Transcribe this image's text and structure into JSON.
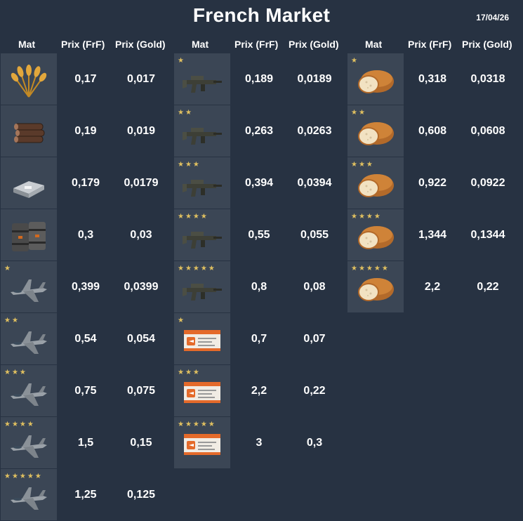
{
  "title": "French Market",
  "date": "17/04/26",
  "headers": {
    "mat": "Mat",
    "frf": "Prix (FrF)",
    "gold": "Prix (Gold)"
  },
  "columns": [
    {
      "items": [
        {
          "icon": "wheat-icon",
          "stars": "",
          "frf": "0,17",
          "gold": "0,017"
        },
        {
          "icon": "logs-icon",
          "stars": "",
          "frf": "0,19",
          "gold": "0,019"
        },
        {
          "icon": "steel-ingot-icon",
          "stars": "",
          "frf": "0,179",
          "gold": "0,0179"
        },
        {
          "icon": "oil-barrel-icon",
          "stars": "",
          "frf": "0,3",
          "gold": "0,03"
        },
        {
          "icon": "fighter-jet-icon",
          "stars": "★",
          "frf": "0,399",
          "gold": "0,0399"
        },
        {
          "icon": "fighter-jet-icon",
          "stars": "★★",
          "frf": "0,54",
          "gold": "0,054"
        },
        {
          "icon": "fighter-jet-icon",
          "stars": "★★★",
          "frf": "0,75",
          "gold": "0,075"
        },
        {
          "icon": "fighter-jet-icon",
          "stars": "★★★★",
          "frf": "1,5",
          "gold": "0,15"
        },
        {
          "icon": "fighter-jet-icon",
          "stars": "★★★★★",
          "frf": "1,25",
          "gold": "0,125"
        }
      ]
    },
    {
      "items": [
        {
          "icon": "rifle-icon",
          "stars": "★",
          "frf": "0,189",
          "gold": "0,0189"
        },
        {
          "icon": "rifle-icon",
          "stars": "★★",
          "frf": "0,263",
          "gold": "0,0263"
        },
        {
          "icon": "rifle-icon",
          "stars": "★★★",
          "frf": "0,394",
          "gold": "0,0394"
        },
        {
          "icon": "rifle-icon",
          "stars": "★★★★",
          "frf": "0,55",
          "gold": "0,055"
        },
        {
          "icon": "rifle-icon",
          "stars": "★★★★★",
          "frf": "0,8",
          "gold": "0,08"
        },
        {
          "icon": "plane-ticket-icon",
          "stars": "★",
          "frf": "0,7",
          "gold": "0,07"
        },
        {
          "icon": "plane-ticket-icon",
          "stars": "★★★",
          "frf": "2,2",
          "gold": "0,22"
        },
        {
          "icon": "plane-ticket-icon",
          "stars": "★★★★★",
          "frf": "3",
          "gold": "0,3"
        }
      ]
    },
    {
      "items": [
        {
          "icon": "bread-icon",
          "stars": "★",
          "frf": "0,318",
          "gold": "0,0318"
        },
        {
          "icon": "bread-icon",
          "stars": "★★",
          "frf": "0,608",
          "gold": "0,0608"
        },
        {
          "icon": "bread-icon",
          "stars": "★★★",
          "frf": "0,922",
          "gold": "0,0922"
        },
        {
          "icon": "bread-icon",
          "stars": "★★★★",
          "frf": "1,344",
          "gold": "0,1344"
        },
        {
          "icon": "bread-icon",
          "stars": "★★★★★",
          "frf": "2,2",
          "gold": "0,22"
        }
      ]
    }
  ]
}
